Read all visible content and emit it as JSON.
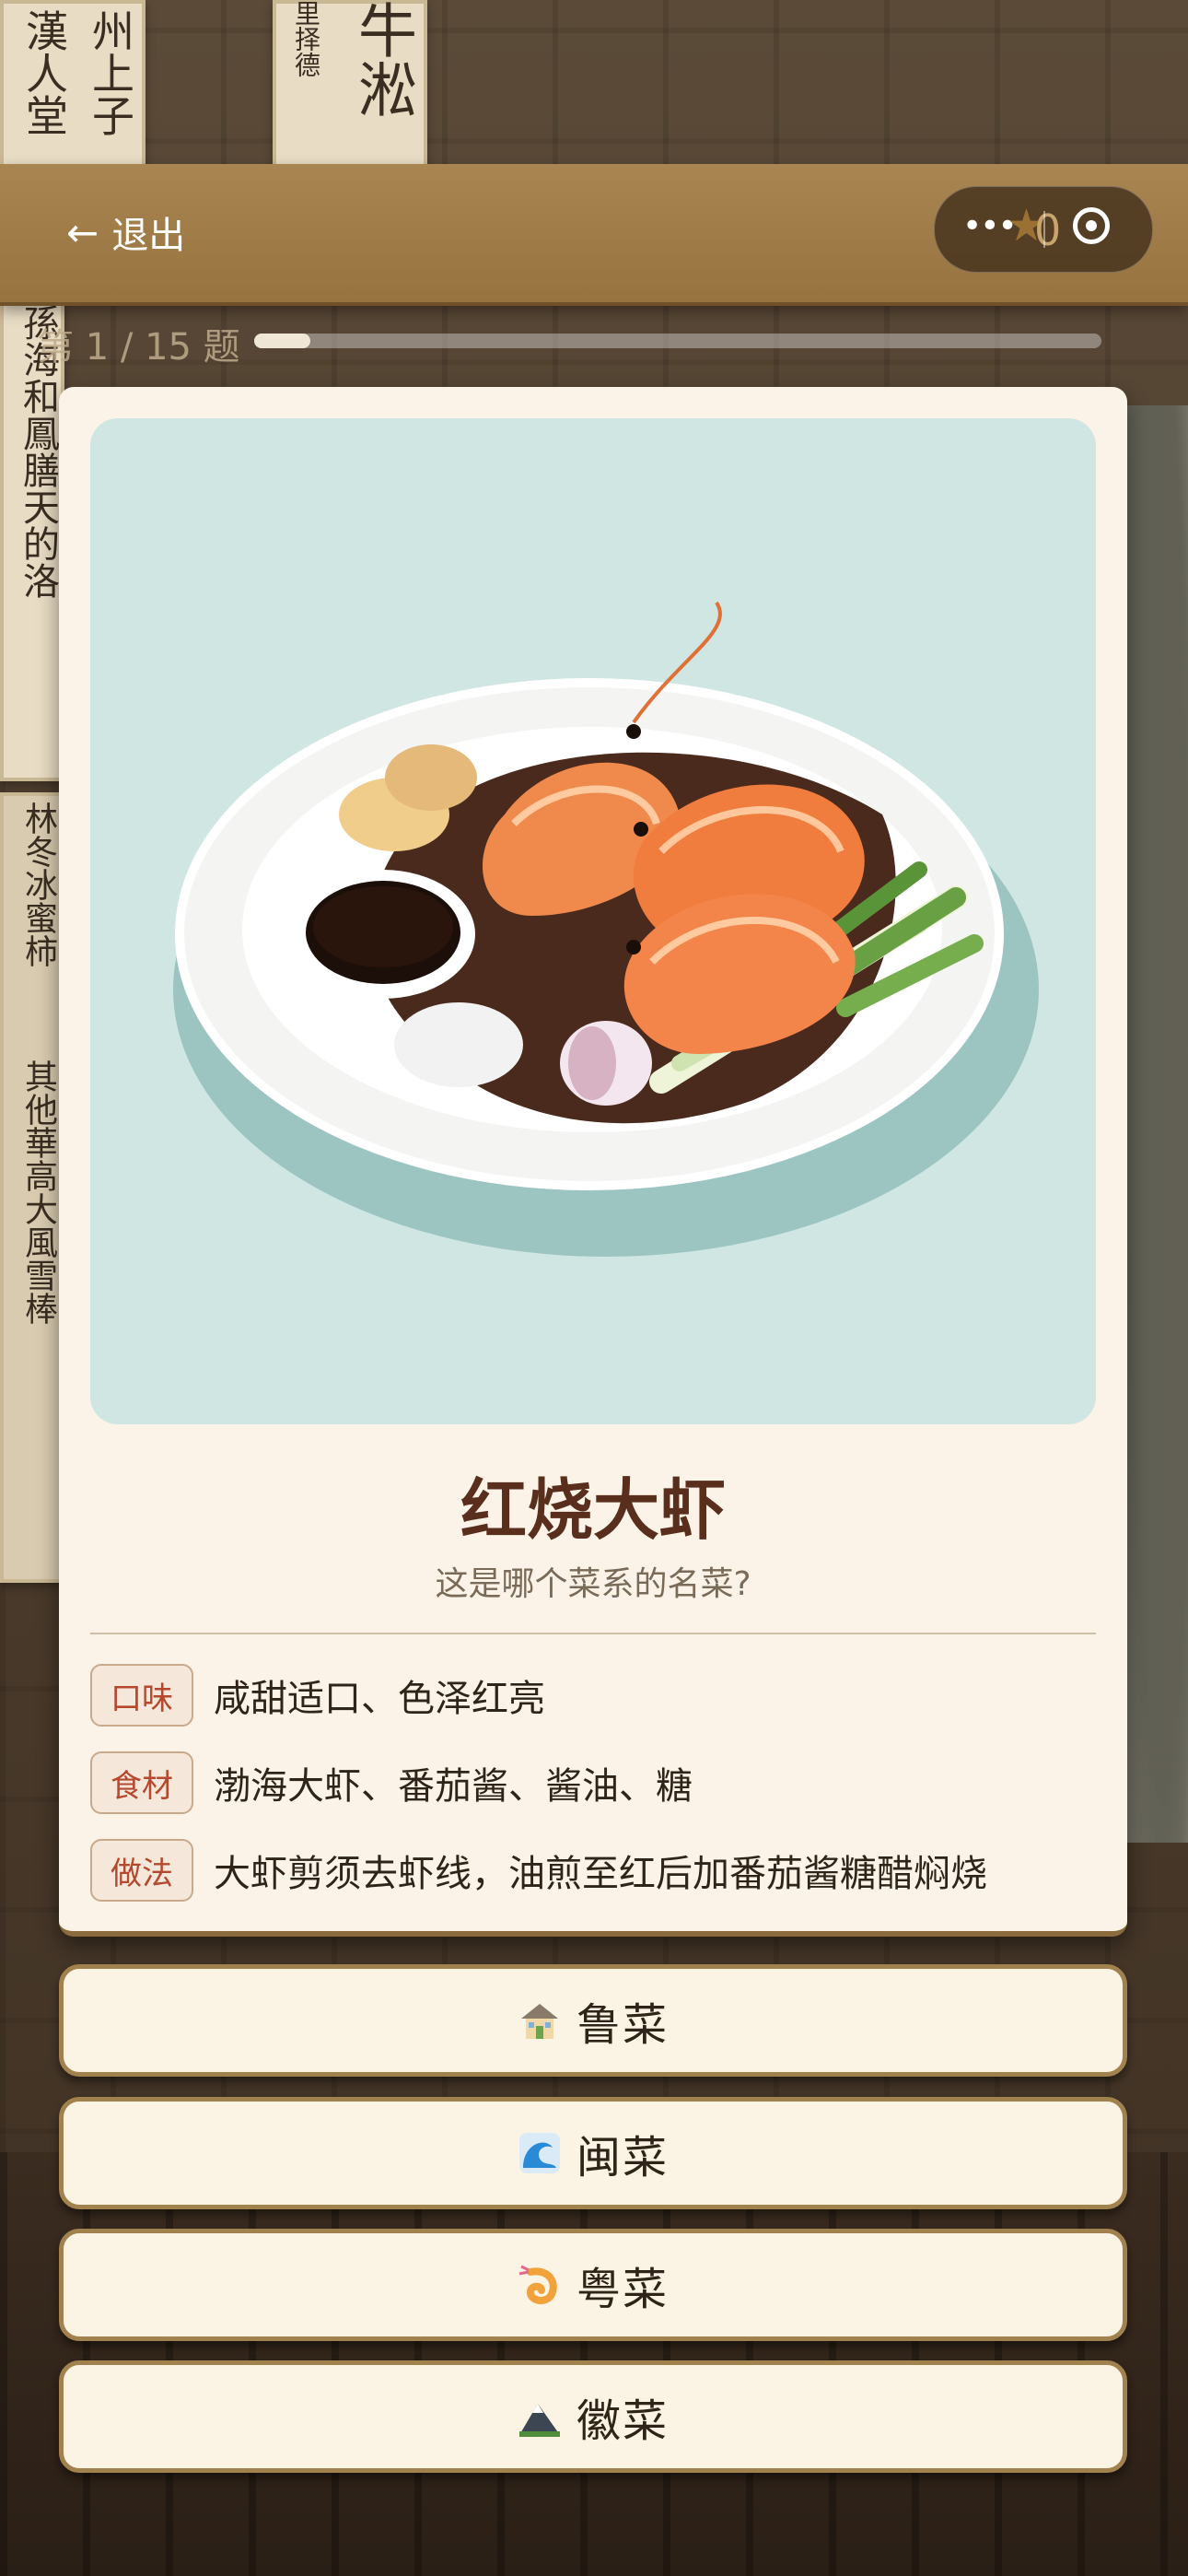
{
  "header": {
    "back_label": "退出",
    "score": "0"
  },
  "progress": {
    "label": "第 1 / 15 题",
    "fraction": 0.0667
  },
  "question": {
    "dish_name": "红烧大虾",
    "prompt": "这是哪个菜系的名菜?",
    "details": [
      {
        "tag": "口味",
        "text": "咸甜适口、色泽红亮"
      },
      {
        "tag": "食材",
        "text": "渤海大虾、番茄酱、酱油、糖"
      },
      {
        "tag": "做法",
        "text": "大虾剪须去虾线，油煎至红后加番茄酱糖醋焖烧"
      }
    ]
  },
  "options": [
    {
      "label": "鲁菜",
      "icon": "house-icon"
    },
    {
      "label": "闽菜",
      "icon": "wave-icon"
    },
    {
      "label": "粤菜",
      "icon": "shrimp-icon"
    },
    {
      "label": "徽菜",
      "icon": "mountain-icon"
    }
  ],
  "background_text": {
    "col1": "州上子",
    "col2": "里择德",
    "col3": "牛淞",
    "col4": "漢人堂",
    "col5": "孫海和鳳膳天的洛",
    "col6": "林冬冰蜜柿",
    "col7": "其他華高大風雪棒"
  },
  "colors": {
    "header": "#a07c47",
    "card": "#fbf3e7",
    "title": "#5a2e1c",
    "tag_text": "#b5482e",
    "option_border": "#a1824f"
  }
}
